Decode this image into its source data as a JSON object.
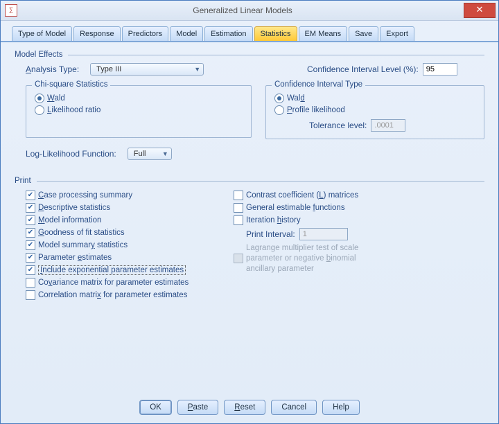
{
  "window": {
    "title": "Generalized Linear Models",
    "close": "✕"
  },
  "tabs": {
    "type_of_model": "Type of Model",
    "response": "Response",
    "predictors": "Predictors",
    "model": "Model",
    "estimation": "Estimation",
    "statistics": "Statistics",
    "em_means": "EM Means",
    "save": "Save",
    "export": "Export"
  },
  "model_effects": {
    "header": "Model Effects",
    "analysis_type_label_pre": "A",
    "analysis_type_label_post": "nalysis Type:",
    "analysis_type_value": "Type III",
    "conf_level_label": "Confidence Interval Level (%):",
    "conf_level_value": "95",
    "chi_square": {
      "legend": "Chi-square Statistics",
      "wald_pre": "W",
      "wald_post": "ald",
      "lr_pre": "L",
      "lr_post": "ikelihood ratio"
    },
    "conf_type": {
      "legend": "Confidence Interval Type",
      "wald_pre": "Wal",
      "wald_u": "d",
      "profile_pre": "P",
      "profile_post": "rofile likelihood",
      "tolerance_label": "Tolerance level:",
      "tolerance_value": ".0001"
    },
    "loglik_label": "Log-Likelihood Function:",
    "loglik_value": "Full"
  },
  "print": {
    "header": "Print",
    "left": {
      "case_pre": "C",
      "case_post": "ase processing summary",
      "desc_pre": "D",
      "desc_post": "escriptive statistics",
      "model_pre": "M",
      "model_post": "odel information",
      "gof_pre": "G",
      "gof_post": "oodness of fit statistics",
      "msum_pre": "Model summar",
      "msum_u": "y",
      "msum_post": " statistics",
      "param_pre": "Parameter ",
      "param_u": "e",
      "param_post": "stimates",
      "incexp_pre": "I",
      "incexp_post": "nclude exponential parameter estimates",
      "cov_pre": "Co",
      "cov_u": "v",
      "cov_post": "ariance matrix for parameter estimates",
      "corr_pre": "Correlation matri",
      "corr_u": "x",
      "corr_post": " for parameter estimates"
    },
    "right": {
      "contrast_pre": "Contrast coefficient (",
      "contrast_u": "L",
      "contrast_post": ") matrices",
      "gef_pre": "General estimable ",
      "gef_u": "f",
      "gef_post": "unctions",
      "iter_pre": "Iteration ",
      "iter_u": "h",
      "iter_post": "istory",
      "print_interval_label": "Print Interval:",
      "print_interval_value": "1",
      "lagrange1": "Lagrange multiplier test of scale",
      "lagrange2_pre": "parameter or negative ",
      "lagrange2_u": "b",
      "lagrange2_post": "inomial",
      "lagrange3": "ancillary parameter"
    }
  },
  "buttons": {
    "ok": "OK",
    "paste_pre": "P",
    "paste_post": "aste",
    "reset_pre": "R",
    "reset_post": "eset",
    "cancel": "Cancel",
    "help": "Help"
  }
}
